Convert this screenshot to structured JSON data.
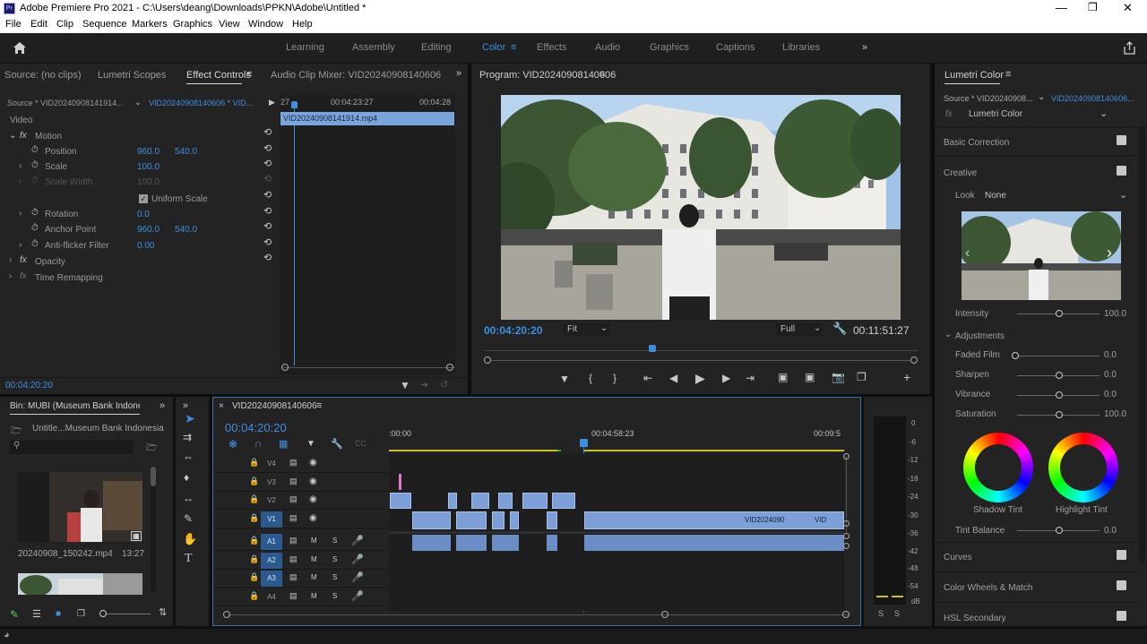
{
  "window": {
    "title": "Adobe Premiere Pro 2021 - C:\\Users\\deang\\Downloads\\PPKN\\Adobe\\Untitled *"
  },
  "menu": [
    "File",
    "Edit",
    "Clip",
    "Sequence",
    "Markers",
    "Graphics",
    "View",
    "Window",
    "Help"
  ],
  "workspaces": {
    "tabs": [
      "Learning",
      "Assembly",
      "Editing",
      "Color",
      "Effects",
      "Audio",
      "Graphics",
      "Captions",
      "Libraries"
    ],
    "active": "Color"
  },
  "source_panel": {
    "tabs": [
      "Source: (no clips)",
      "Lumetri Scopes",
      "Effect Controls",
      "Audio Clip Mixer: VID20240908140606"
    ],
    "active": "Effect Controls",
    "source_label": "Source * VID20240908141914...",
    "sequence_label": "VID20240908140606 * VID...",
    "ruler": {
      "start": "27",
      "mid": "00:04:23:27",
      "end": "00:04:28"
    },
    "clip_name": "VID20240908141914.mp4",
    "video_section": "Video",
    "motion_label": "Motion",
    "props": [
      {
        "name": "Position",
        "v1": "960.0",
        "v2": "540.0"
      },
      {
        "name": "Scale",
        "v1": "100.0",
        "v2": ""
      },
      {
        "name": "Scale Width",
        "v1": "100.0",
        "v2": ""
      },
      {
        "name": "Uniform Scale",
        "v1": "",
        "v2": ""
      },
      {
        "name": "Rotation",
        "v1": "0.0",
        "v2": ""
      },
      {
        "name": "Anchor Point",
        "v1": "960.0",
        "v2": "540.0"
      },
      {
        "name": "Anti-flicker Filter",
        "v1": "0.00",
        "v2": ""
      }
    ],
    "opacity_label": "Opacity",
    "time_remap_label": "Time Remapping",
    "timecode": "00:04:20:20"
  },
  "program": {
    "title": "Program: VID20240908140606",
    "timecode": "00:04:20:20",
    "fit": "Fit",
    "quality": "Full",
    "duration": "00:11:51:27"
  },
  "project": {
    "bin": "Bin: MUBI (Museum Bank Indonesi",
    "path": "Untitle...Museum Bank Indonesia",
    "item1_name": "20240908_150242.mp4",
    "item1_dur": "13:27"
  },
  "timeline": {
    "seq_name": "VID20240908140606",
    "timecode": "00:04:20:20",
    "ruler": {
      "start": ":00:00",
      "mid": "00:04:58:23",
      "end": "00:09:5"
    },
    "video_tracks": [
      "V4",
      "V3",
      "V2",
      "V1"
    ],
    "audio_tracks": [
      "A1",
      "A2",
      "A3",
      "A4"
    ],
    "clip_label": "VID2024090",
    "clip_label2": "VID"
  },
  "meter": {
    "scale": [
      "0",
      "-6",
      "-12",
      "-18",
      "-24",
      "-30",
      "-36",
      "-42",
      "-48",
      "-54",
      "dB"
    ],
    "solo": [
      "S",
      "S"
    ]
  },
  "lumetri": {
    "title": "Lumetri Color",
    "source": "Source * VID20240908...",
    "seq": "VID20240908140606...",
    "effect": "Lumetri Color",
    "basic": "Basic Correction",
    "creative": "Creative",
    "look_label": "Look",
    "look_value": "None",
    "intensity_label": "Intensity",
    "intensity": "100.0",
    "adjustments": "Adjustments",
    "faded_label": "Faded Film",
    "faded": "0.0",
    "sharpen_label": "Sharpen",
    "sharpen": "0.0",
    "vibrance_label": "Vibrance",
    "vibrance": "0.0",
    "saturation_label": "Saturation",
    "saturation": "100.0",
    "shadow_tint": "Shadow Tint",
    "highlight_tint": "Highlight Tint",
    "tint_balance_label": "Tint Balance",
    "tint_balance": "0.0",
    "curves": "Curves",
    "wheels": "Color Wheels & Match",
    "hsl": "HSL Secondary"
  }
}
